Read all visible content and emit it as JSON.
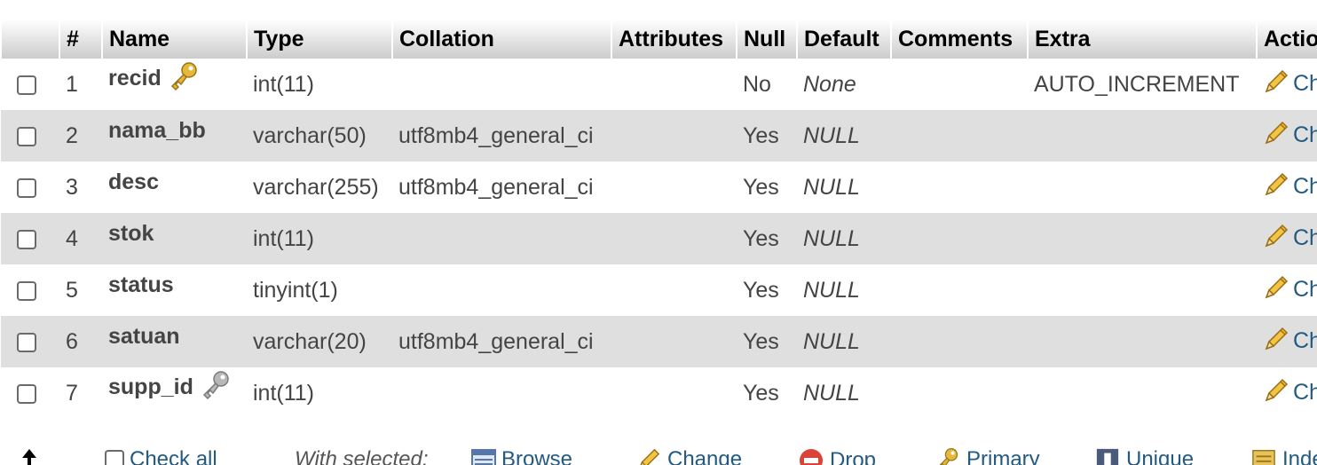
{
  "columns": [
    "",
    "#",
    "Name",
    "Type",
    "Collation",
    "Attributes",
    "Null",
    "Default",
    "Comments",
    "Extra",
    "Action"
  ],
  "rows": [
    {
      "num": "1",
      "name": "recid",
      "key": "primary",
      "type": "int(11)",
      "collation": "",
      "attributes": "",
      "null": "No",
      "default": "None",
      "comments": "",
      "extra": "AUTO_INCREMENT",
      "action": "Change"
    },
    {
      "num": "2",
      "name": "nama_bb",
      "key": "",
      "type": "varchar(50)",
      "collation": "utf8mb4_general_ci",
      "attributes": "",
      "null": "Yes",
      "default": "NULL",
      "comments": "",
      "extra": "",
      "action": "Change"
    },
    {
      "num": "3",
      "name": "desc",
      "key": "",
      "type": "varchar(255)",
      "collation": "utf8mb4_general_ci",
      "attributes": "",
      "null": "Yes",
      "default": "NULL",
      "comments": "",
      "extra": "",
      "action": "Change"
    },
    {
      "num": "4",
      "name": "stok",
      "key": "",
      "type": "int(11)",
      "collation": "",
      "attributes": "",
      "null": "Yes",
      "default": "NULL",
      "comments": "",
      "extra": "",
      "action": "Change"
    },
    {
      "num": "5",
      "name": "status",
      "key": "",
      "type": "tinyint(1)",
      "collation": "",
      "attributes": "",
      "null": "Yes",
      "default": "NULL",
      "comments": "",
      "extra": "",
      "action": "Change"
    },
    {
      "num": "6",
      "name": "satuan",
      "key": "",
      "type": "varchar(20)",
      "collation": "utf8mb4_general_ci",
      "attributes": "",
      "null": "Yes",
      "default": "NULL",
      "comments": "",
      "extra": "",
      "action": "Change"
    },
    {
      "num": "7",
      "name": "supp_id",
      "key": "index",
      "type": "int(11)",
      "collation": "",
      "attributes": "",
      "null": "Yes",
      "default": "NULL",
      "comments": "",
      "extra": "",
      "action": "Change"
    }
  ],
  "footer": {
    "check_all": "Check all",
    "with_selected": "With selected:",
    "browse": "Browse",
    "change": "Change",
    "drop": "Drop",
    "primary": "Primary",
    "unique": "Unique",
    "index": "Index"
  },
  "colors": {
    "header_top": "#ffffff",
    "header_bottom": "#cccccc",
    "even_row": "#dfdfdf",
    "link": "#235a81",
    "key_gold": "#e5b83a"
  }
}
